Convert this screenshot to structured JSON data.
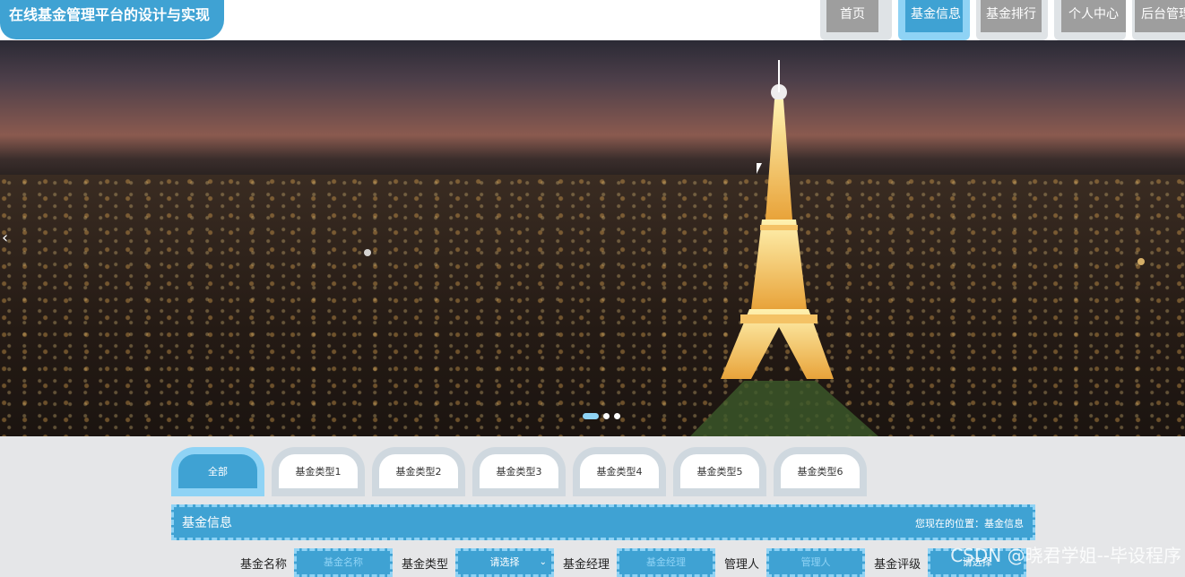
{
  "header": {
    "title": "在线基金管理平台的设计与实现",
    "nav": [
      {
        "label": "首页",
        "active": false
      },
      {
        "label": "基金信息",
        "active": true
      },
      {
        "label": "基金排行",
        "active": false
      },
      {
        "label": "个人中心",
        "active": false
      },
      {
        "label": "后台管理",
        "active": false
      }
    ]
  },
  "banner": {
    "prev_icon": "chevron-left-icon",
    "dots": 3,
    "active_dot": 0
  },
  "tabs": [
    {
      "label": "全部",
      "active": true
    },
    {
      "label": "基金类型1",
      "active": false
    },
    {
      "label": "基金类型2",
      "active": false
    },
    {
      "label": "基金类型3",
      "active": false
    },
    {
      "label": "基金类型4",
      "active": false
    },
    {
      "label": "基金类型5",
      "active": false
    },
    {
      "label": "基金类型6",
      "active": false
    }
  ],
  "section": {
    "title": "基金信息",
    "location": "您现在的位置：基金信息"
  },
  "filters": {
    "fund_name_label": "基金名称",
    "fund_name_placeholder": "基金名称",
    "fund_type_label": "基金类型",
    "fund_type_value": "请选择",
    "manager_label": "基金经理",
    "manager_placeholder": "基金经理",
    "admin_label": "管理人",
    "admin_placeholder": "管理人",
    "rating_label": "基金评级",
    "rating_value": "请选择"
  },
  "watermark": "CSDN @晓君学姐--毕设程序",
  "colors": {
    "accent": "#3fa2d3",
    "accent_light": "#8fd3f5",
    "page_bg": "#e5e6e8"
  }
}
